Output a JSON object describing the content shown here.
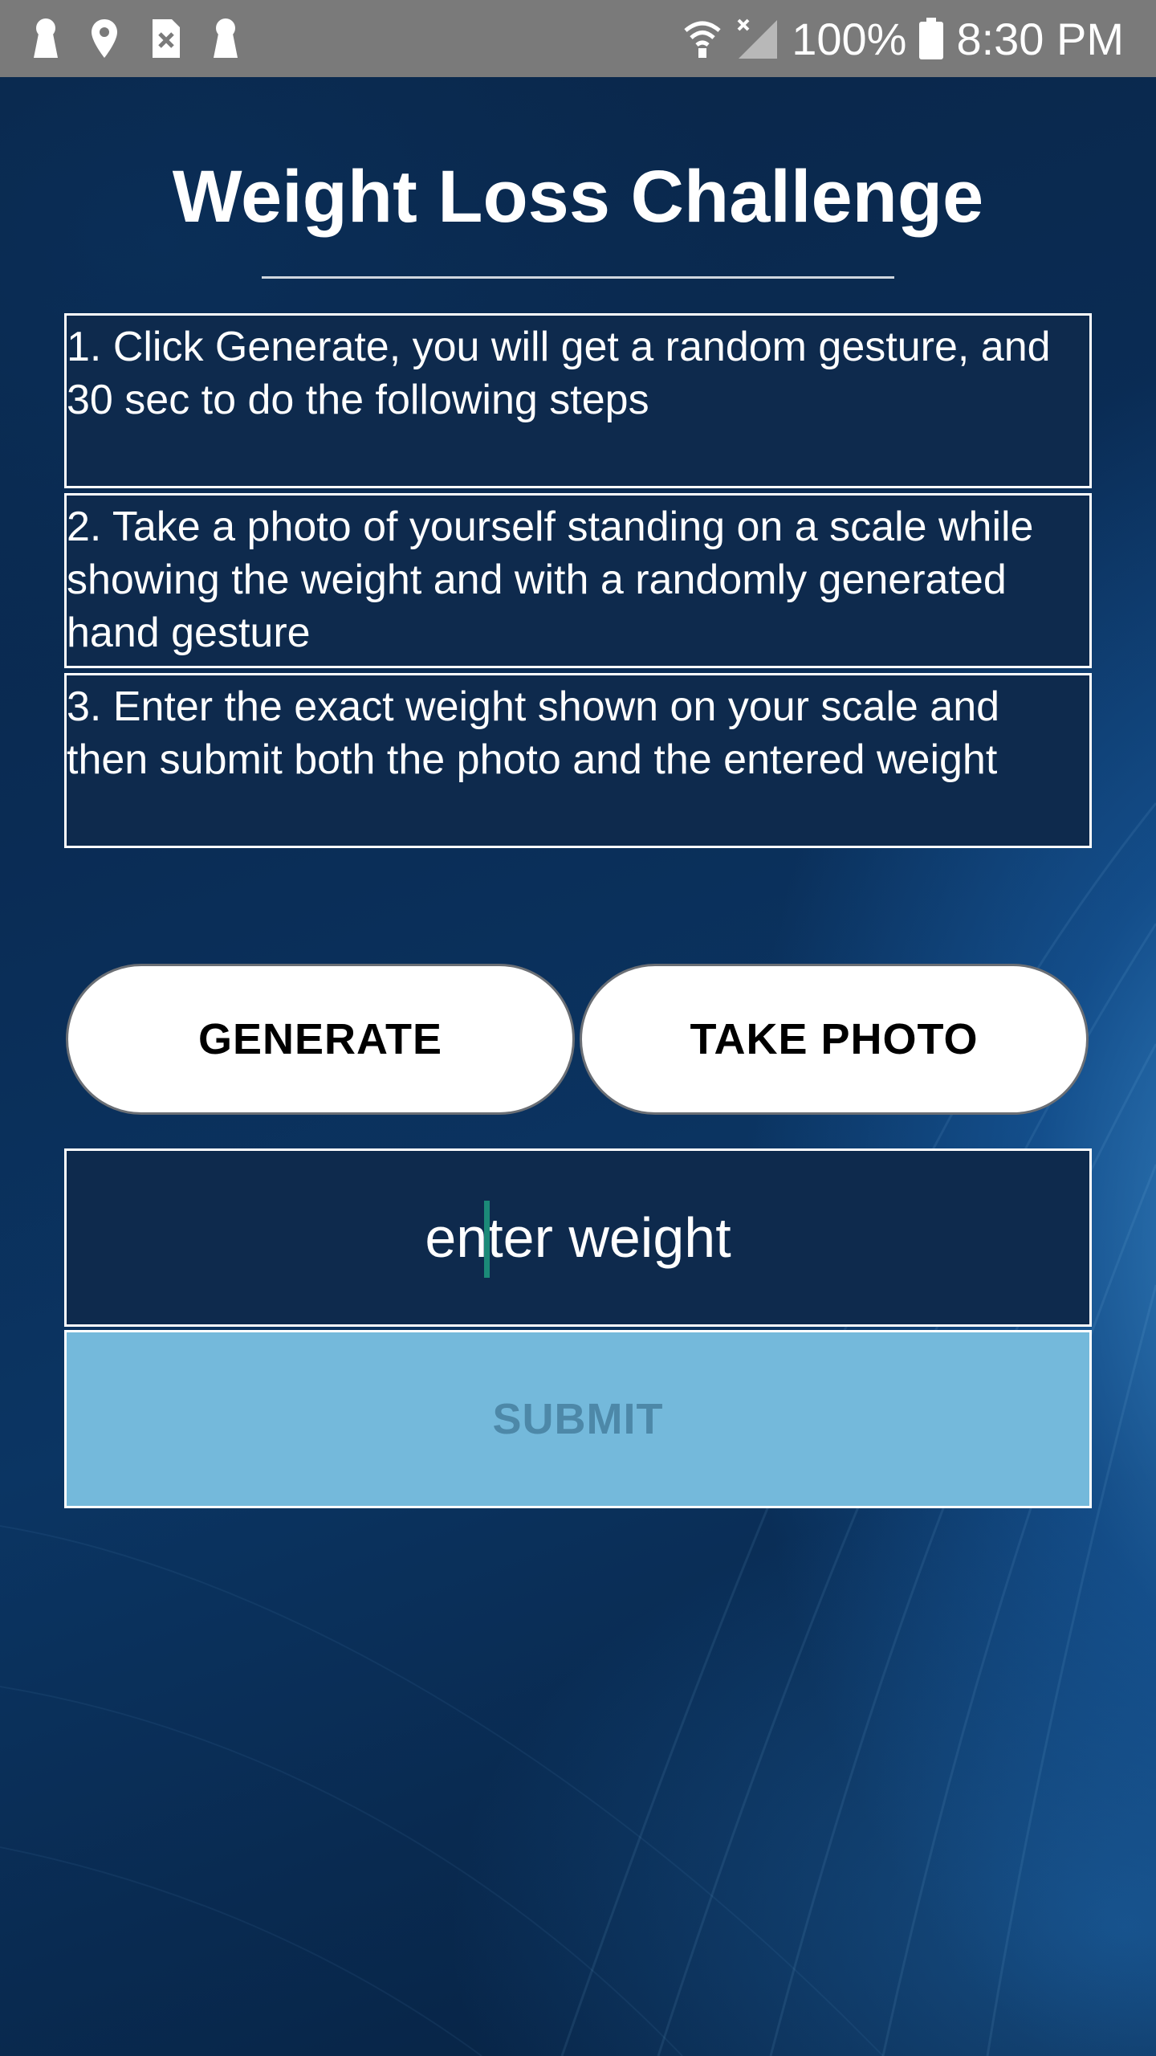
{
  "status_bar": {
    "icons": [
      "keyhole-icon",
      "location-pin-icon",
      "sim-error-icon",
      "keyhole-icon",
      "wifi-icon",
      "no-signal-icon",
      "battery-icon"
    ],
    "battery": "100%",
    "time": "8:30 PM"
  },
  "app": {
    "title": "Weight Loss Challenge"
  },
  "instructions": [
    {
      "text": "1. Click Generate, you will get a random gesture, and 30 sec to do the following steps"
    },
    {
      "text": "2. Take a photo of yourself standing on a scale while showing the weight and with a randomly generated hand gesture"
    },
    {
      "text": "3. Enter the exact weight shown on your scale and then submit both the photo and the entered weight"
    }
  ],
  "buttons": {
    "generate": "GENERATE",
    "take_photo": "TAKE PHOTO",
    "submit": "SUBMIT"
  },
  "weight_input": {
    "placeholder": "enter weight",
    "value": ""
  },
  "colors": {
    "panel_bg": "#0e2a4d",
    "submit_bg": "#74b9db",
    "submit_text": "#4d88a8",
    "caret": "#1b8a78",
    "status_bar_bg": "#7a7a7a"
  }
}
